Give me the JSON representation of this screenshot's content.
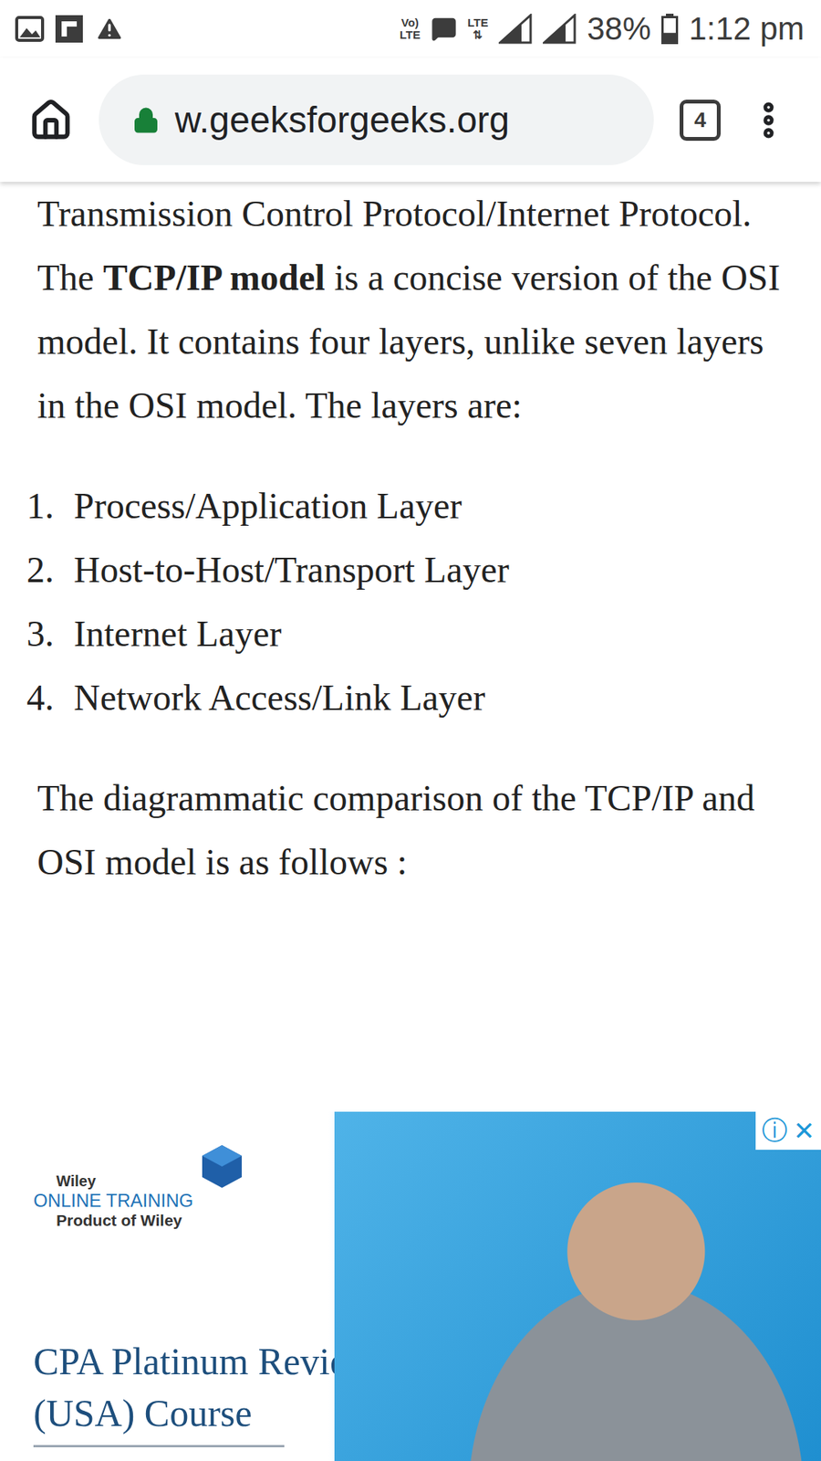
{
  "status_bar": {
    "volte": [
      "Vo)",
      "LTE"
    ],
    "network": "LTE",
    "battery": "38%",
    "battery_level": 0.38,
    "time": "1:12 pm"
  },
  "browser": {
    "url": "w.geeksforgeeks.org",
    "secure": true,
    "tab_count": "4"
  },
  "article": {
    "intro": [
      {
        "text": "Transmission Control Protocol/Internet Protocol. The ",
        "bold": false
      },
      {
        "text": "TCP/IP model",
        "bold": true
      },
      {
        "text": " is a concise version of the OSI model. It contains four layers, unlike seven layers in the OSI model. The layers are:",
        "bold": false
      }
    ],
    "list": [
      {
        "number": "1.",
        "text": "Process/Application Layer"
      },
      {
        "number": "2.",
        "text": "Host-to-Host/Transport Layer"
      },
      {
        "number": "3.",
        "text": "Internet Layer"
      },
      {
        "number": "4.",
        "text": "Network Access/Link Layer"
      }
    ],
    "outro": [
      {
        "text": "The diagrammatic comparison of the TCP/IP and OSI model is as follows :",
        "bold": false
      }
    ]
  },
  "ad": {
    "brand": "Wiley",
    "brand_tagline": "ONLINE TRAINING",
    "brand_sub": "Product of Wiley",
    "headline": [
      "CPA Platinum Review",
      "(USA) Course"
    ],
    "info": "ⓘ",
    "close": "✕"
  }
}
